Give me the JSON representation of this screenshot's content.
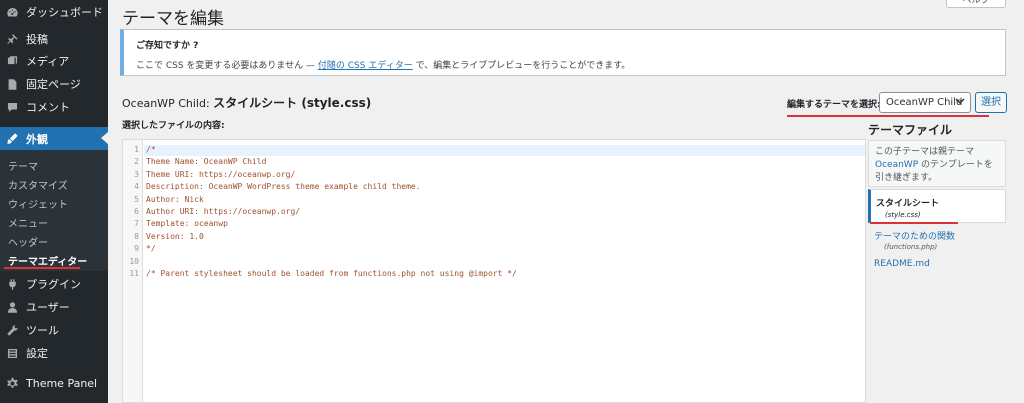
{
  "sidebar": {
    "items": [
      {
        "label": "ダッシュボード",
        "icon": "dashboard-icon"
      },
      {
        "label": "投稿",
        "icon": "pin-icon"
      },
      {
        "label": "メディア",
        "icon": "media-icon"
      },
      {
        "label": "固定ページ",
        "icon": "page-icon"
      },
      {
        "label": "コメント",
        "icon": "comment-icon"
      },
      {
        "label": "外観",
        "icon": "brush-icon"
      },
      {
        "label": "プラグイン",
        "icon": "plugin-icon"
      },
      {
        "label": "ユーザー",
        "icon": "user-icon"
      },
      {
        "label": "ツール",
        "icon": "wrench-icon"
      },
      {
        "label": "設定",
        "icon": "settings-icon"
      },
      {
        "label": "Theme Panel",
        "icon": "gear-icon"
      }
    ],
    "submenu": [
      "テーマ",
      "カスタマイズ",
      "ウィジェット",
      "メニュー",
      "ヘッダー",
      "テーマエディター"
    ]
  },
  "header": {
    "title": "テーマを編集",
    "help_tab": "ヘルプ"
  },
  "notice": {
    "title": "ご存知ですか ?",
    "text_before": "ここで CSS を変更する必要はありません — ",
    "link": "付随の CSS エディター",
    "text_after": " で、編集とライブプレビューを行うことができます。"
  },
  "editor": {
    "theme_name": "OceanWP Child:",
    "file_title": "スタイルシート (style.css)",
    "content_label": "選択したファイルの内容:",
    "select_label": "編集するテーマを選択:",
    "selected_theme": "OceanWP Child",
    "select_button": "選択",
    "lines": [
      "/*",
      "Theme Name: OceanWP Child",
      "Theme URI: https://oceanwp.org/",
      "Description: OceanWP WordPress theme example child theme.",
      "Author: Nick",
      "Author URI: https://oceanwp.org/",
      "Template: oceanwp",
      "Version: 1.0",
      "*/",
      "",
      "/* Parent stylesheet should be loaded from functions.php not using @import */"
    ]
  },
  "theme_files": {
    "heading": "テーマファイル",
    "desc_before": "この子テーマは親テーマ ",
    "desc_link": "OceanWP",
    "desc_after": " のテンプレートを引き継ぎます。",
    "files": [
      {
        "name": "スタイルシート",
        "sub": "(style.css)"
      },
      {
        "name": "テーマのための関数",
        "sub": "(functions.php)"
      },
      {
        "name": "README.md",
        "sub": ""
      }
    ]
  },
  "colors": {
    "sidebar_bg": "#23282d",
    "accent": "#2271b1",
    "highlight_line": "#d63638"
  }
}
